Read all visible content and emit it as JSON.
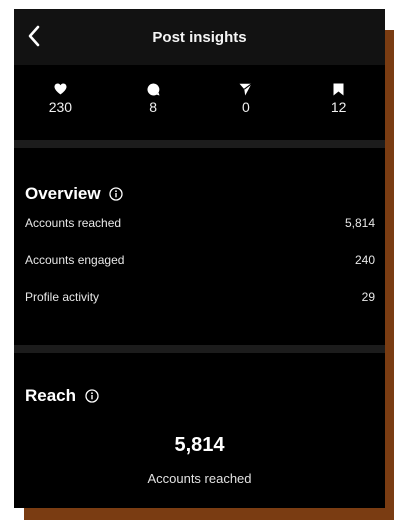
{
  "header": {
    "title": "Post insights",
    "back_icon": "chevron-left-icon"
  },
  "stats": [
    {
      "icon": "heart-icon",
      "value": "230"
    },
    {
      "icon": "comment-icon",
      "value": "8"
    },
    {
      "icon": "share-icon",
      "value": "0"
    },
    {
      "icon": "bookmark-icon",
      "value": "12"
    }
  ],
  "overview": {
    "title": "Overview",
    "metrics": [
      {
        "label": "Accounts reached",
        "value": "5,814"
      },
      {
        "label": "Accounts engaged",
        "value": "240"
      },
      {
        "label": "Profile activity",
        "value": "29"
      }
    ]
  },
  "reach": {
    "title": "Reach",
    "value": "5,814",
    "label": "Accounts reached"
  },
  "colors": {
    "background": "#000000",
    "header_bg": "#121212",
    "divider": "#1c1c1c",
    "text": "#ffffff",
    "frame_shadow": "#7a3c12"
  }
}
